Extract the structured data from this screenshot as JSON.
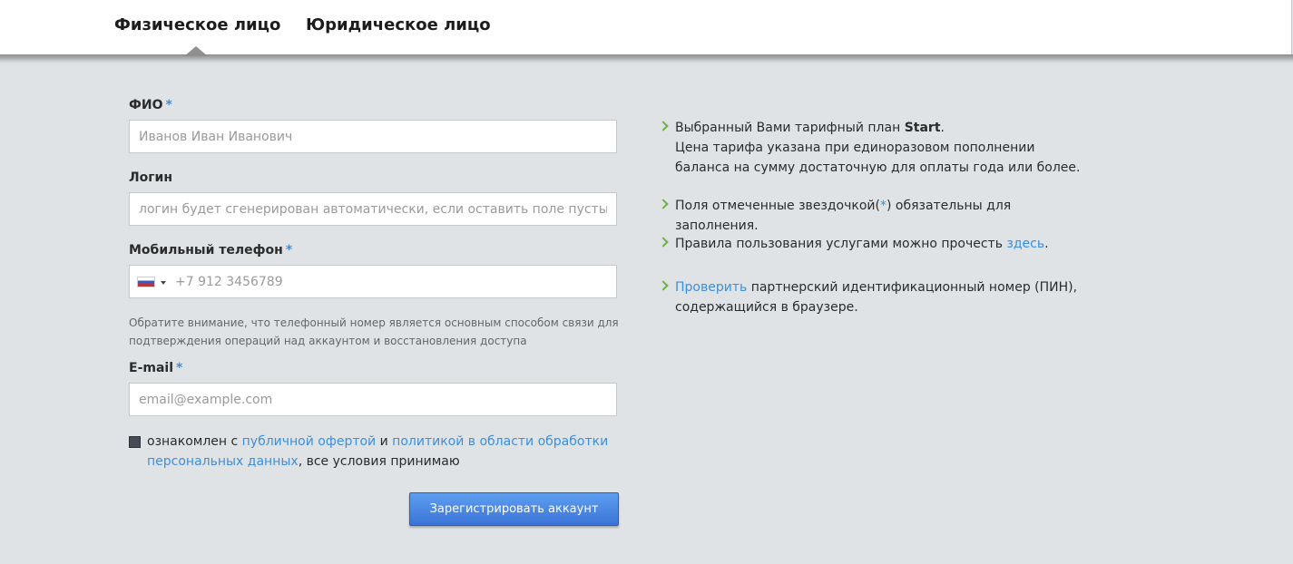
{
  "tabs": [
    {
      "label": "Физическое лицо",
      "active": true
    },
    {
      "label": "Юридическое лицо",
      "active": false
    }
  ],
  "form": {
    "fio": {
      "label": "ФИО",
      "required_mark": "*",
      "value": "",
      "placeholder": "Иванов Иван Иванович"
    },
    "login": {
      "label": "Логин",
      "value": "",
      "placeholder": "логин будет сгенерирован автоматически, если оставить поле пустым"
    },
    "phone": {
      "label": "Мобильный телефон",
      "required_mark": "*",
      "value": "",
      "placeholder": "+7 912 3456789",
      "country_flag": "ru-flag-icon"
    },
    "phone_note": "Обратите внимание, что телефонный номер является основным способом связи для подтверждения операций над аккаунтом и восстановления доступа",
    "email": {
      "label": "E-mail",
      "required_mark": "*",
      "value": "",
      "placeholder": "email@example.com"
    },
    "consent": {
      "checked": true,
      "text_1": "ознакомлен с",
      "link_1": "публичной офертой",
      "text_2": "и",
      "link_2": "политикой в области обработки персональных данных",
      "text_3": ", все условия принимаю"
    },
    "submit_label": "Зарегистрировать аккаунт"
  },
  "info": {
    "plan": {
      "prefix": "Выбранный Вами тарифный план",
      "plan_name": "Start",
      "suffix": ".",
      "line_2": "Цена тарифа указана при единоразовом пополнении баланса на сумму достаточную для оплаты года или более."
    },
    "required": {
      "prefix": "Поля отмеченные звездочкой(",
      "mark": "*",
      "suffix": ") обязательны для заполнения."
    },
    "rules": {
      "prefix": "Правила пользования услугами можно прочесть",
      "link": "здесь",
      "suffix": "."
    },
    "pin": {
      "link": "Проверить",
      "text": "партнерский идентификационный номер (ПИН), содержащийся в браузере."
    }
  },
  "colors": {
    "accent": "#3d8fdb",
    "chevron": "#6bb33a",
    "page_bg": "#dfe3e6",
    "button": "#4a86e8"
  }
}
